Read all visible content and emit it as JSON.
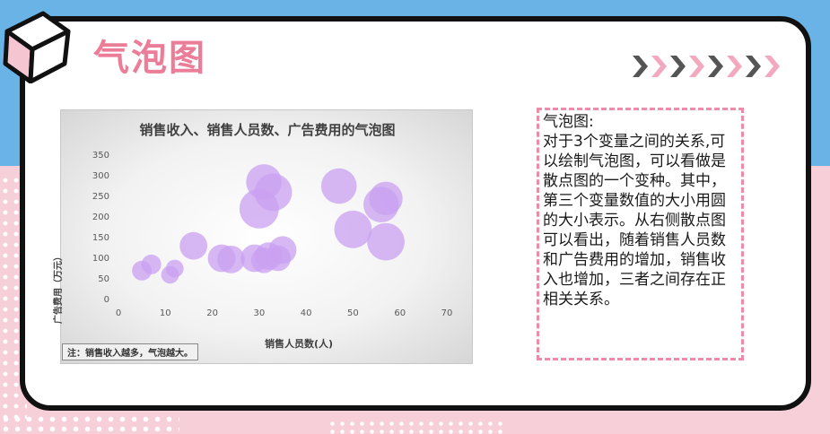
{
  "page": {
    "title": "气泡图"
  },
  "description": {
    "heading": "气泡图:",
    "body": "对于3个变量之间的关系,可以绘制气泡图，可以看做是散点图的一个变种。其中，第三个变量数值的大小用圆的大小表示。从右侧散点图可以看出，随着销售人员数和广告费用的增加，销售收入也增加，三者之间存在正相关关系。"
  },
  "colors": {
    "accent_pink": "#ec7d98",
    "bubble_fill": "#c9a0f2",
    "dashed_border": "#ef8aa8",
    "background_blue": "#6ab3e6",
    "background_pink": "#f7cfd9"
  },
  "icons": {
    "cube": "cube-icon",
    "chevrons": "chevron-row-icon"
  },
  "chart_data": {
    "type": "scatter",
    "subtype": "bubble",
    "title": "销售收入、销售人员数、广告费用的气泡图",
    "xlabel": "销售人员数(人)",
    "ylabel": "广告费用（万元）",
    "note": "注：销售收入越多，气泡越大。",
    "xlim": [
      0,
      70
    ],
    "ylim": [
      0,
      350
    ],
    "xticks": [
      "0",
      "10",
      "20",
      "30",
      "40",
      "50",
      "60",
      "70"
    ],
    "yticks": [
      "0",
      "50",
      "100",
      "150",
      "200",
      "250",
      "300",
      "350"
    ],
    "grid": false,
    "legend": false,
    "series": [
      {
        "points": [
          {
            "x": 5,
            "y": 70,
            "size": 1.0
          },
          {
            "x": 7,
            "y": 85,
            "size": 1.0
          },
          {
            "x": 11,
            "y": 60,
            "size": 0.9
          },
          {
            "x": 12,
            "y": 75,
            "size": 0.9
          },
          {
            "x": 16,
            "y": 130,
            "size": 1.4
          },
          {
            "x": 22,
            "y": 100,
            "size": 1.4
          },
          {
            "x": 24,
            "y": 97,
            "size": 1.4
          },
          {
            "x": 29,
            "y": 100,
            "size": 1.4
          },
          {
            "x": 31,
            "y": 95,
            "size": 1.3
          },
          {
            "x": 32,
            "y": 105,
            "size": 1.4
          },
          {
            "x": 34,
            "y": 100,
            "size": 1.3
          },
          {
            "x": 35,
            "y": 120,
            "size": 1.4
          },
          {
            "x": 30,
            "y": 220,
            "size": 2.0
          },
          {
            "x": 31,
            "y": 285,
            "size": 1.8
          },
          {
            "x": 33,
            "y": 260,
            "size": 1.9
          },
          {
            "x": 47,
            "y": 275,
            "size": 1.8
          },
          {
            "x": 50,
            "y": 170,
            "size": 1.9
          },
          {
            "x": 56,
            "y": 230,
            "size": 1.8
          },
          {
            "x": 57,
            "y": 245,
            "size": 1.7
          },
          {
            "x": 57,
            "y": 140,
            "size": 1.9
          }
        ]
      }
    ]
  }
}
